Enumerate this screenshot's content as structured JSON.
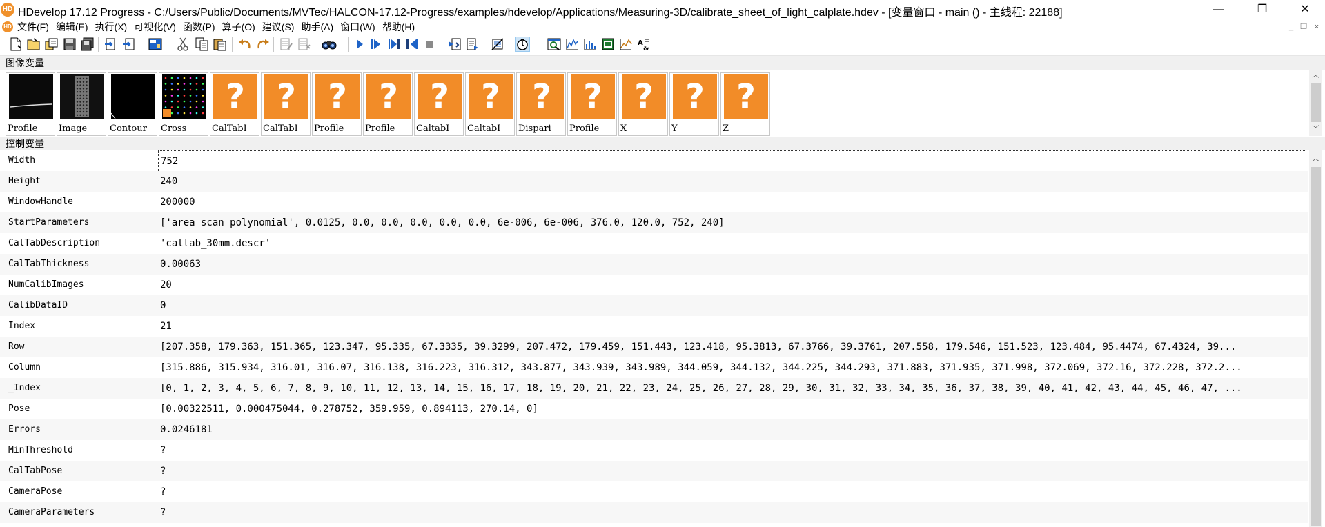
{
  "window": {
    "title": "HDevelop 17.12 Progress - C:/Users/Public/Documents/MVTec/HALCON-17.12-Progress/examples/hdevelop/Applications/Measuring-3D/calibrate_sheet_of_light_calplate.hdev - [变量窗口 - main () - 主线程: 22188]",
    "app_icon_text": "HD",
    "minimize": "—",
    "restore": "❐",
    "close": "✕"
  },
  "menu": {
    "items": [
      "文件(F)",
      "编辑(E)",
      "执行(X)",
      "可视化(V)",
      "函数(P)",
      "算子(O)",
      "建议(S)",
      "助手(A)",
      "窗口(W)",
      "帮助(H)"
    ],
    "mdi_minimize": "_",
    "mdi_restore": "❐",
    "mdi_close": "×"
  },
  "toolbar": {
    "buttons": [
      "new-file-icon",
      "open-file-icon",
      "browse-examples-icon",
      "save-icon",
      "save-all-icon",
      "insert-icon",
      "step-into-icon",
      "program-icon",
      "cut-icon",
      "copy-icon",
      "paste-icon",
      "undo-icon",
      "redo-icon",
      "comment-icon",
      "uncomment-icon",
      "find-icon",
      "run-icon",
      "step-over-icon",
      "step-into-proc-icon",
      "step-out-icon",
      "stop-icon",
      "reset-program-icon",
      "reset-procedure-icon",
      "activate-icon",
      "profiler-icon",
      "graphics-window-icon",
      "histogram-icon",
      "line-profile-icon",
      "feature-histogram-icon",
      "feature-inspection-icon",
      "ocr-icon"
    ]
  },
  "image_section": {
    "header": "图像变量",
    "items": [
      {
        "label": "Profile",
        "kind": "profile"
      },
      {
        "label": "Image",
        "kind": "image"
      },
      {
        "label": "Contour",
        "kind": "contour"
      },
      {
        "label": "Cross",
        "kind": "cross"
      },
      {
        "label": "CalTabI",
        "kind": "unknown"
      },
      {
        "label": "CalTabI",
        "kind": "unknown"
      },
      {
        "label": "Profile",
        "kind": "unknown"
      },
      {
        "label": "Profile",
        "kind": "unknown"
      },
      {
        "label": "CaltabI",
        "kind": "unknown"
      },
      {
        "label": "CaltabI",
        "kind": "unknown"
      },
      {
        "label": "Dispari",
        "kind": "unknown"
      },
      {
        "label": "Profile",
        "kind": "unknown"
      },
      {
        "label": "X",
        "kind": "unknown"
      },
      {
        "label": "Y",
        "kind": "unknown"
      },
      {
        "label": "Z",
        "kind": "unknown"
      }
    ],
    "unknown_glyph": "?",
    "cross_badge": "+1"
  },
  "control_section": {
    "header": "控制变量",
    "rows": [
      {
        "name": "Width",
        "value": "752"
      },
      {
        "name": "Height",
        "value": "240"
      },
      {
        "name": "WindowHandle",
        "value": "200000"
      },
      {
        "name": "StartParameters",
        "value": "['area_scan_polynomial', 0.0125, 0.0, 0.0, 0.0, 0.0, 0.0, 6e-006, 6e-006, 376.0, 120.0, 752, 240]"
      },
      {
        "name": "CalTabDescription",
        "value": "'caltab_30mm.descr'"
      },
      {
        "name": "CalTabThickness",
        "value": "0.00063"
      },
      {
        "name": "NumCalibImages",
        "value": "20"
      },
      {
        "name": "CalibDataID",
        "value": "0"
      },
      {
        "name": "Index",
        "value": "21"
      },
      {
        "name": "Row",
        "value": "[207.358, 179.363, 151.365, 123.347, 95.335, 67.3335, 39.3299, 207.472, 179.459, 151.443, 123.418, 95.3813, 67.3766, 39.3761, 207.558, 179.546, 151.523, 123.484, 95.4474, 67.4324, 39..."
      },
      {
        "name": "Column",
        "value": "[315.886, 315.934, 316.01, 316.07, 316.138, 316.223, 316.312, 343.877, 343.939, 343.989, 344.059, 344.132, 344.225, 344.293, 371.883, 371.935, 371.998, 372.069, 372.16, 372.228, 372.2..."
      },
      {
        "name": "_Index",
        "value": "[0, 1, 2, 3, 4, 5, 6, 7, 8, 9, 10, 11, 12, 13, 14, 15, 16, 17, 18, 19, 20, 21, 22, 23, 24, 25, 26, 27, 28, 29, 30, 31, 32, 33, 34, 35, 36, 37, 38, 39, 40, 41, 42, 43, 44, 45, 46, 47, ..."
      },
      {
        "name": "Pose",
        "value": "[0.00322511, 0.000475044, 0.278752, 359.959, 0.894113, 270.14, 0]"
      },
      {
        "name": "Errors",
        "value": "0.0246181"
      },
      {
        "name": "MinThreshold",
        "value": "?"
      },
      {
        "name": "CalTabPose",
        "value": "?"
      },
      {
        "name": "CameraPose",
        "value": "?"
      },
      {
        "name": "CameraParameters",
        "value": "?"
      }
    ]
  },
  "colors": {
    "accent_orange": "#f28c28",
    "selection_blue": "#cde4f7"
  }
}
